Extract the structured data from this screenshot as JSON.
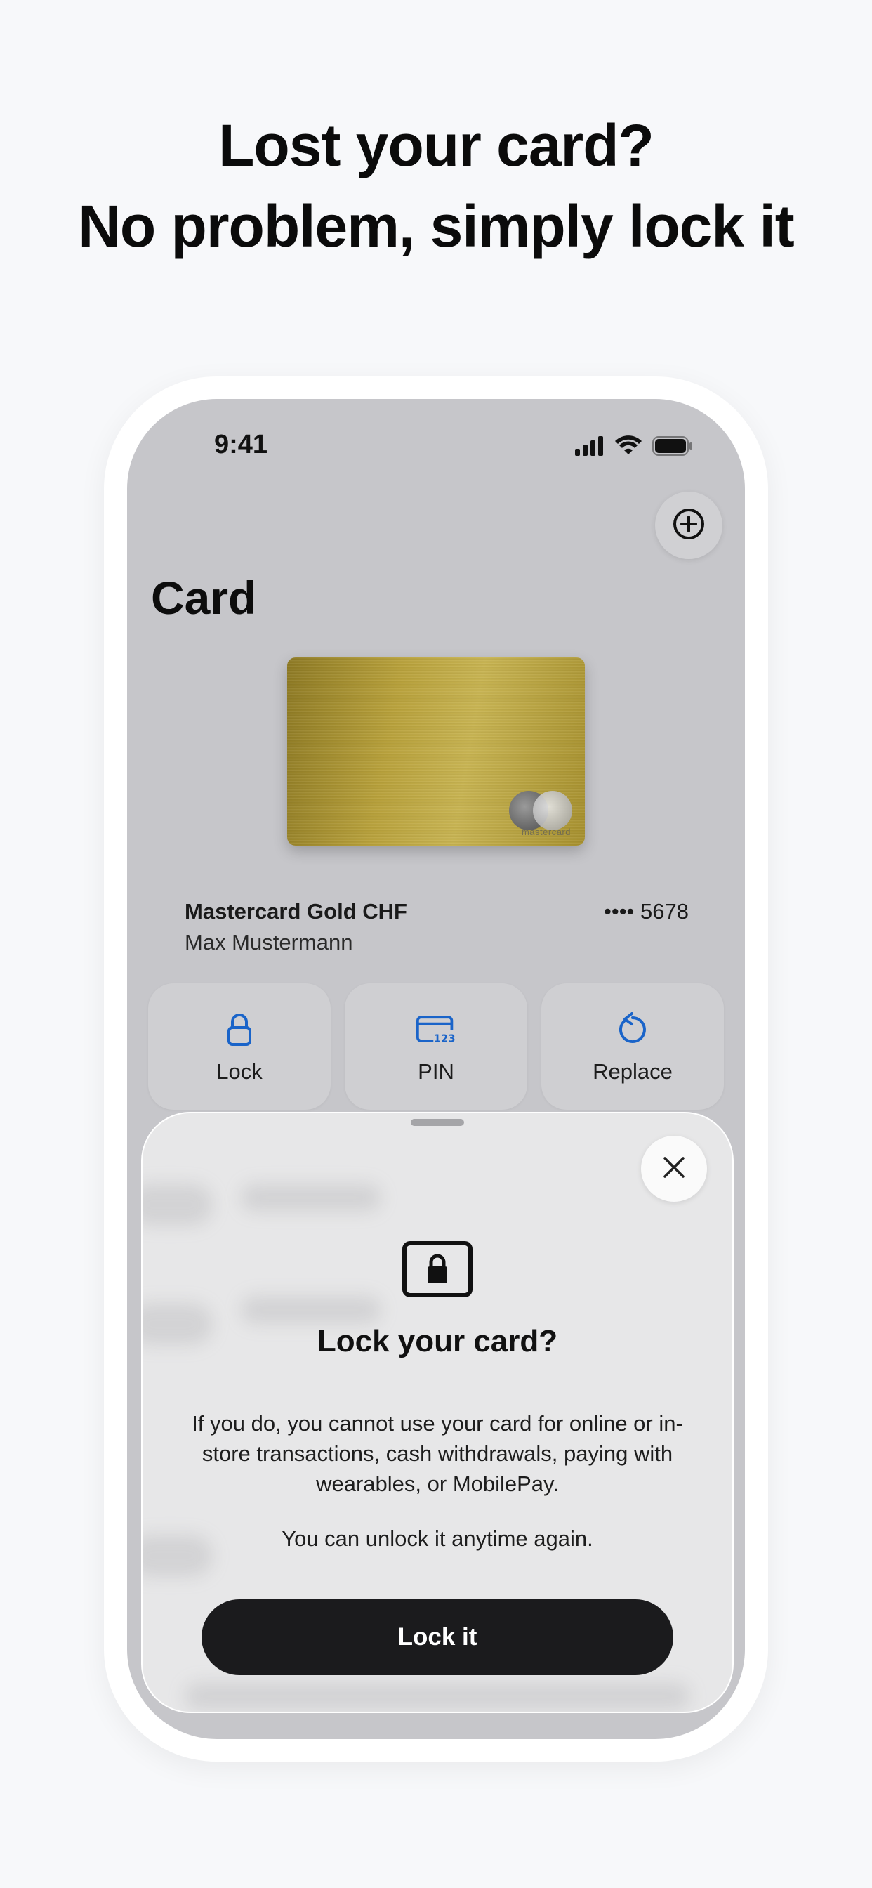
{
  "headline": {
    "line1": "Lost your card?",
    "line2": "No problem, simply lock it"
  },
  "status_bar": {
    "time": "9:41",
    "icons": [
      "signal-icon",
      "wifi-icon",
      "battery-icon"
    ]
  },
  "header": {
    "title": "Card",
    "add_icon": "plus-circle-icon"
  },
  "card": {
    "brand_word": "mastercard",
    "name": "Mastercard Gold CHF",
    "holder": "Max Mustermann",
    "number": "•••• 5678"
  },
  "actions": [
    {
      "label": "Lock",
      "icon": "lock-icon"
    },
    {
      "label": "PIN",
      "icon": "pin-card-icon"
    },
    {
      "label": "Replace",
      "icon": "replace-icon"
    }
  ],
  "sheet": {
    "title": "Lock your card?",
    "body": "If you do, you cannot use your card for online or in-store transactions, cash withdrawals, paying with wearables, or MobilePay.",
    "note": "You can unlock it anytime again.",
    "primary_label": "Lock it",
    "close_icon": "close-icon",
    "illustration_icon": "card-lock-icon"
  },
  "colors": {
    "background": "#f7f8fa",
    "screen_bg": "#c6c6ca",
    "accent_blue": "#1a64c9",
    "primary_button": "#1b1b1d"
  }
}
